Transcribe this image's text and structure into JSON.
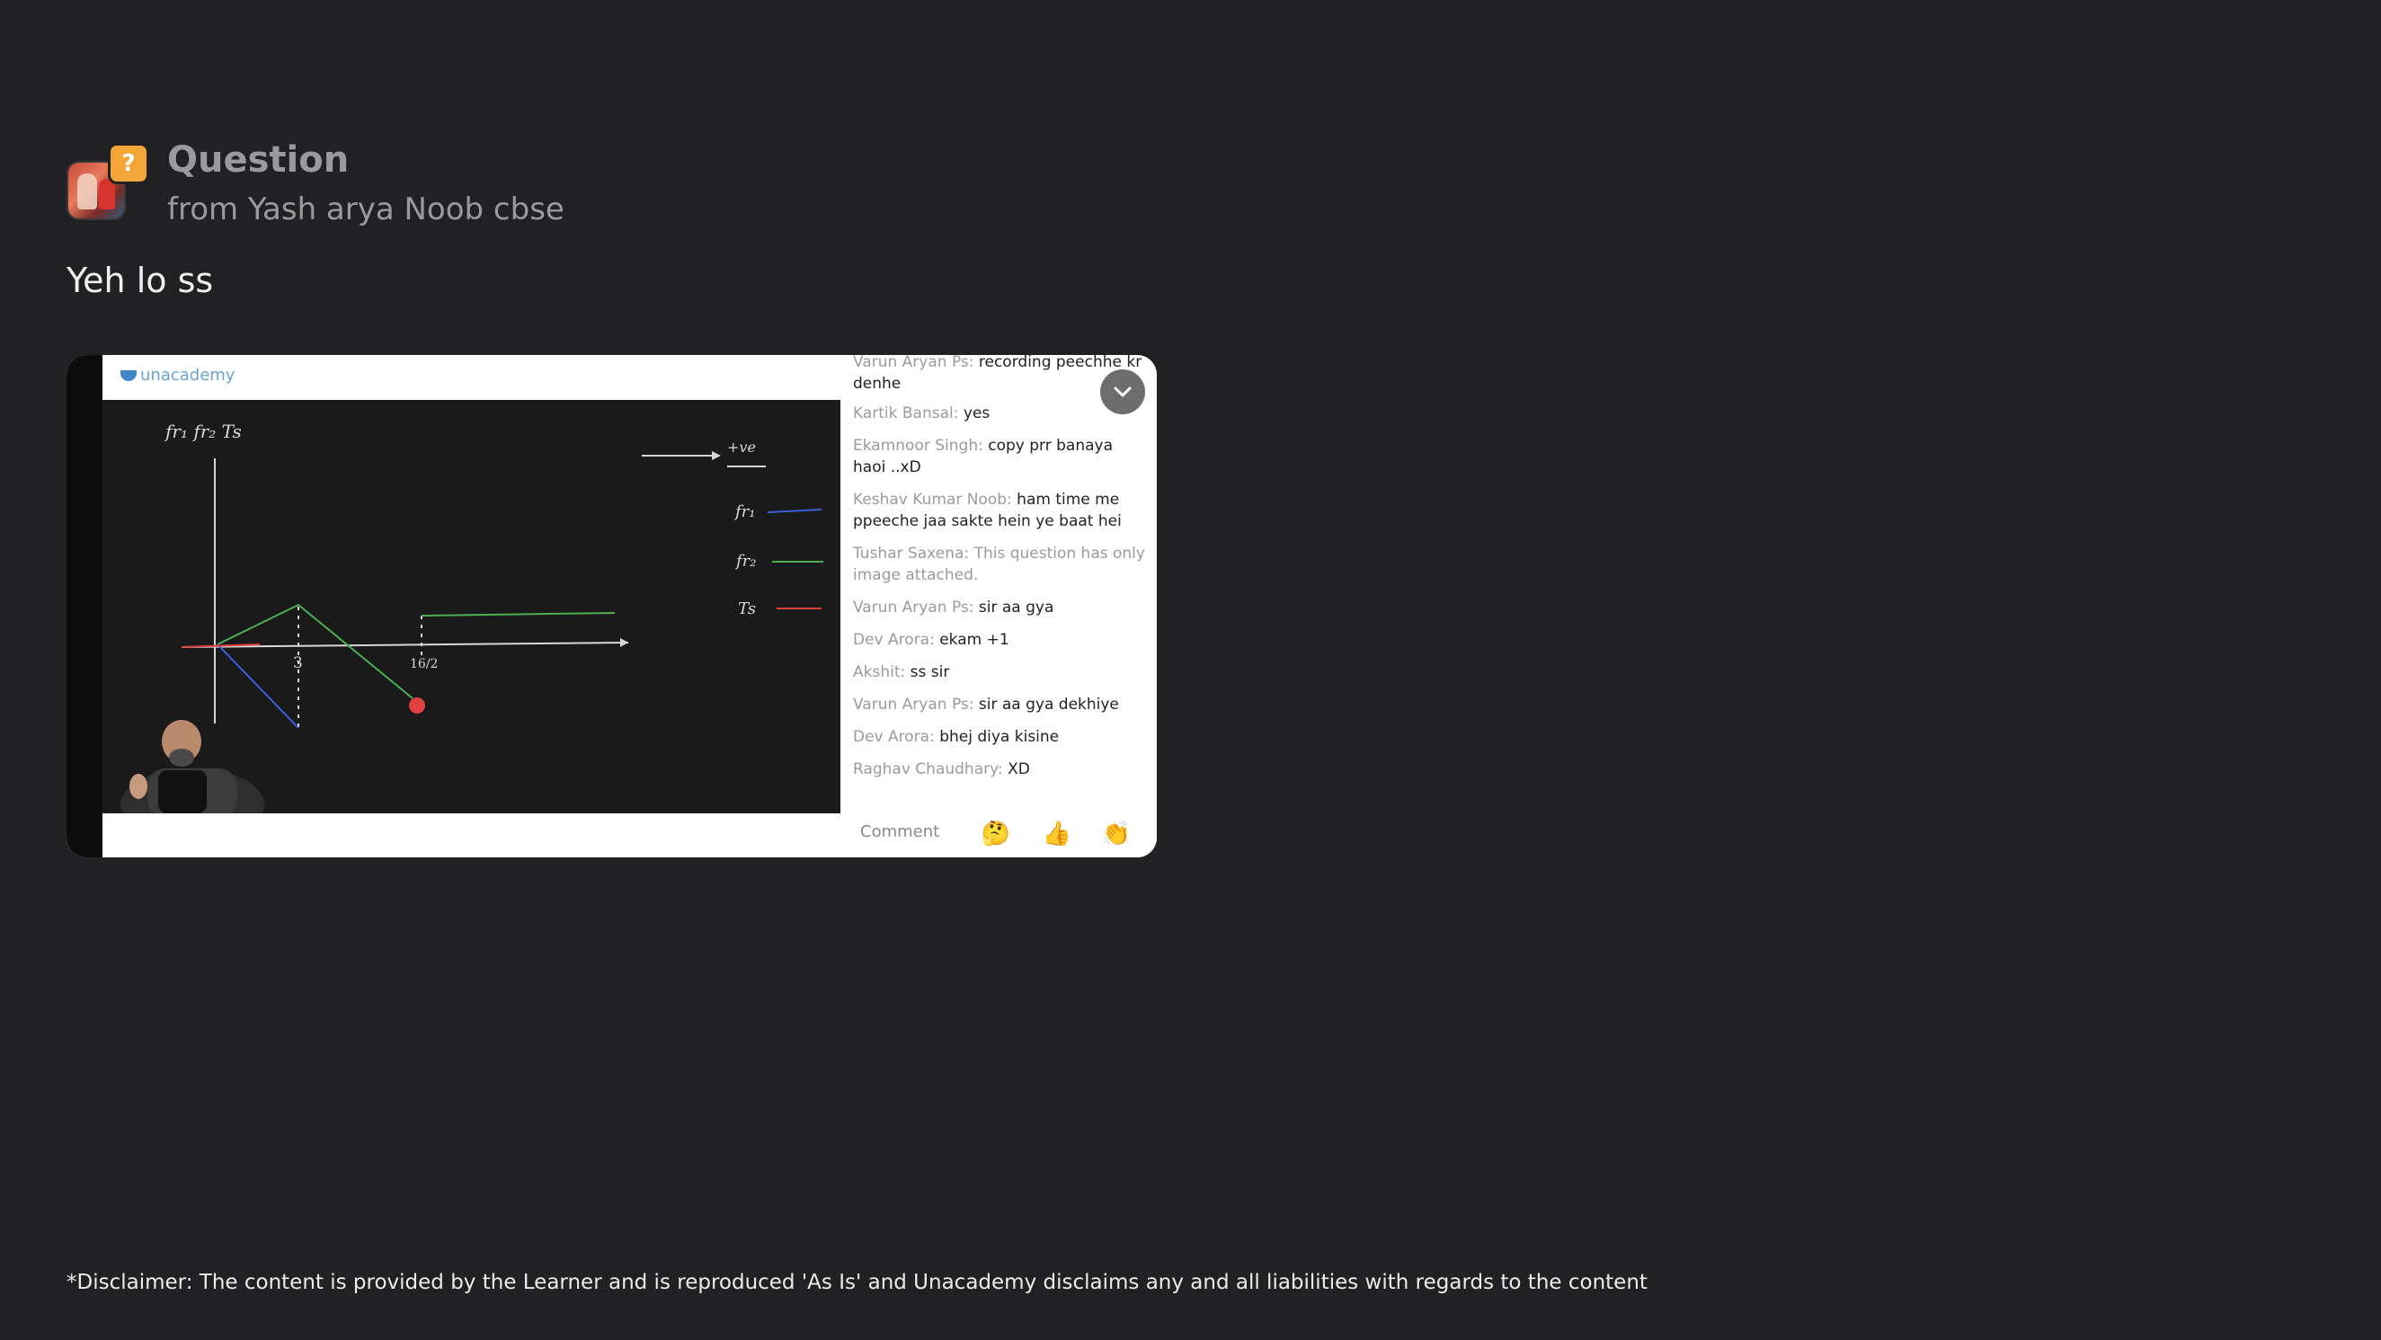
{
  "header": {
    "title": "Question",
    "subtitle": "from Yash arya Noob cbse",
    "badge_icon": "question-mark",
    "badge_text": "?"
  },
  "caption": "Yeh lo ss",
  "screenshot": {
    "brand": "unacademy",
    "board_labels": {
      "axis_label": "fr₁ fr₂ Ts",
      "arrow_label": "+ve",
      "legend": [
        "fr₁",
        "fr₂",
        "Ts"
      ],
      "tick_3": "3",
      "tick_frac": "16/2"
    },
    "chat": [
      {
        "user": "Varun Aryan Ps:",
        "text": "recording peechhe kr denhe"
      },
      {
        "user": "Kartik Bansal:",
        "text": "yes"
      },
      {
        "user": "Ekamnoor Singh:",
        "text": "copy prr banaya haoi ..xD"
      },
      {
        "user": "Keshav Kumar Noob:",
        "text": "ham time me ppeeche jaa sakte hein ye baat hei"
      },
      {
        "user": "Tushar Saxena:",
        "text": "This question has only image attached.",
        "muted": true
      },
      {
        "user": "Varun Aryan Ps:",
        "text": "sir aa gya"
      },
      {
        "user": "Dev Arora:",
        "text": "ekam +1"
      },
      {
        "user": "Akshit:",
        "text": "ss sir"
      },
      {
        "user": "Varun Aryan Ps:",
        "text": "sir aa gya dekhiye"
      },
      {
        "user": "Dev Arora:",
        "text": "bhej diya kisine"
      },
      {
        "user": "Raghav Chaudhary:",
        "text": "XD"
      }
    ],
    "comment_placeholder": "Comment",
    "emojis": [
      "🤔",
      "👍",
      "👏"
    ],
    "collapse_icon": "chevron-down"
  },
  "disclaimer": "*Disclaimer: The content is provided by the Learner and is reproduced 'As Is' and Unacademy disclaims any and all liabilities with regards to the content",
  "colors": {
    "background": "#212123",
    "badge": "#f3a637",
    "muted_text": "#9a9a9c",
    "line_red": "#d9403a",
    "line_green": "#4caf50",
    "line_blue": "#3a5fd9"
  }
}
